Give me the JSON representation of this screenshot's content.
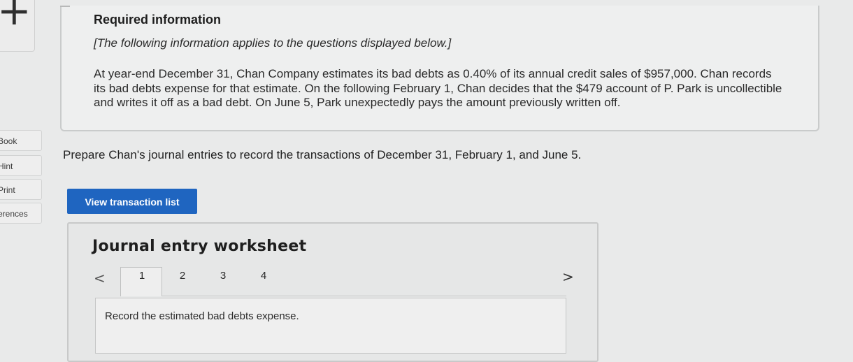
{
  "sidebar": {
    "logo_glyph": "+",
    "items": [
      {
        "label": "Book"
      },
      {
        "label": "Hint"
      },
      {
        "label": "Print"
      },
      {
        "label": "erences"
      }
    ]
  },
  "info": {
    "title": "Required information",
    "subtitle": "[The following information applies to the questions displayed below.]",
    "paragraph": "At year-end December 31, Chan Company estimates its bad debts as 0.40% of its annual credit sales of $957,000. Chan records its bad debts expense for that estimate. On the following February 1, Chan decides that the $479 account of P. Park is uncollectible and writes it off as a bad debt. On June 5, Park unexpectedly pays the amount previously written off."
  },
  "question": {
    "prompt": "Prepare Chan's journal entries to record the transactions of December 31, February 1, and June 5."
  },
  "buttons": {
    "view_transaction_list": "View transaction list"
  },
  "worksheet": {
    "title": "Journal entry worksheet",
    "prev_glyph": "<",
    "next_glyph": ">",
    "tabs": [
      "1",
      "2",
      "3",
      "4"
    ],
    "active_tab": "1",
    "instruction": "Record the estimated bad debts expense."
  }
}
